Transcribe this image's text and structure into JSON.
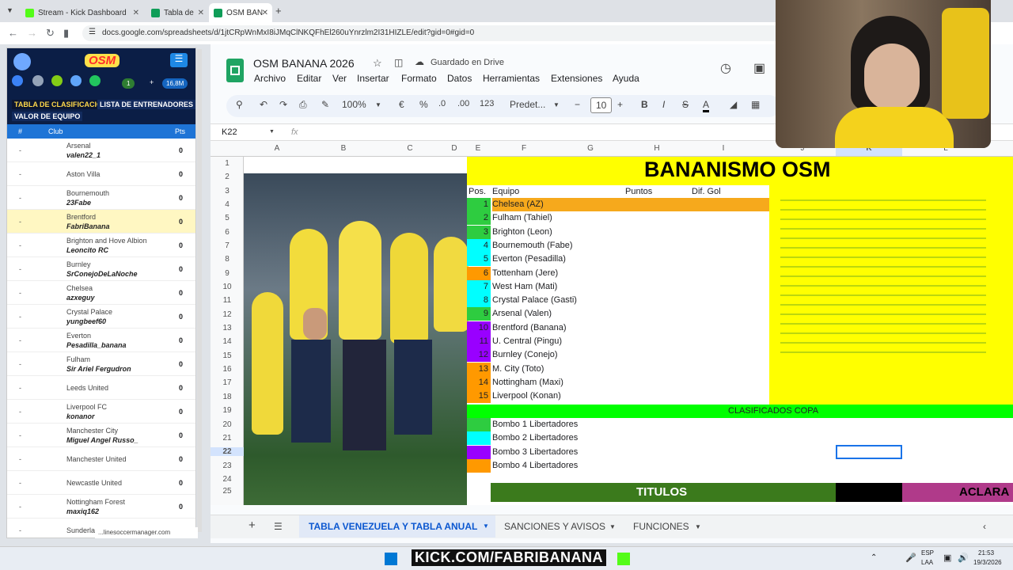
{
  "browser": {
    "tabs": [
      {
        "label": "Stream - Kick Dashboard",
        "color": "#53fc18"
      },
      {
        "label": "Tabla de",
        "color": "#0f9d58"
      },
      {
        "label": "OSM BAN",
        "color": "#0f9d58"
      }
    ],
    "new_tab": "+",
    "url": "docs.google.com/spreadsheets/d/1jtCRpWnMxI8iJMqClNKQFhEl260uYnrzlm2I31HIZLE/edit?gid=0#gid=0"
  },
  "osm": {
    "logo": "OSM",
    "coins": "1",
    "money": "16,8M",
    "nav": [
      "TABLA DE CLASIFICACIÓN",
      "LISTA DE ENTRENADORES",
      "VALOR DE EQUIPO"
    ],
    "header": {
      "num": "#",
      "club": "Club",
      "pts": "Pts"
    },
    "rows": [
      {
        "dash": "-",
        "club": "Arsenal",
        "manager": "valen22_1",
        "pts": "0"
      },
      {
        "dash": "-",
        "club": "Aston Villa",
        "manager": "",
        "pts": "0"
      },
      {
        "dash": "-",
        "club": "Bournemouth",
        "manager": "23Fabe",
        "pts": "0"
      },
      {
        "dash": "-",
        "club": "Brentford",
        "manager": "FabriBanana",
        "pts": "0"
      },
      {
        "dash": "-",
        "club": "Brighton and Hove Albion",
        "manager": "Leoncito RC",
        "pts": "0"
      },
      {
        "dash": "-",
        "club": "Burnley",
        "manager": "SrConejoDeLaNoche",
        "pts": "0"
      },
      {
        "dash": "-",
        "club": "Chelsea",
        "manager": "azxeguy",
        "pts": "0"
      },
      {
        "dash": "-",
        "club": "Crystal Palace",
        "manager": "yungbeef60",
        "pts": "0"
      },
      {
        "dash": "-",
        "club": "Everton",
        "manager": "Pesadilla_banana",
        "pts": "0"
      },
      {
        "dash": "-",
        "club": "Fulham",
        "manager": "Sir Ariel Fergudron",
        "pts": "0"
      },
      {
        "dash": "-",
        "club": "Leeds United",
        "manager": "",
        "pts": "0"
      },
      {
        "dash": "-",
        "club": "Liverpool FC",
        "manager": "konanor",
        "pts": "0"
      },
      {
        "dash": "-",
        "club": "Manchester City",
        "manager": "Miguel Angel Russo_",
        "pts": "0"
      },
      {
        "dash": "-",
        "club": "Manchester United",
        "manager": "",
        "pts": "0"
      },
      {
        "dash": "-",
        "club": "Newcastle United",
        "manager": "",
        "pts": "0"
      },
      {
        "dash": "-",
        "club": "Nottingham Forest",
        "manager": "maxiq162",
        "pts": "0"
      },
      {
        "dash": "-",
        "club": "Sunderland",
        "manager": "",
        "pts": ""
      }
    ],
    "footer": "...linesoccermanager.com"
  },
  "sheets": {
    "title": "OSM BANANA 2026",
    "saved": "Guardado en Drive",
    "menu": [
      "Archivo",
      "Editar",
      "Ver",
      "Insertar",
      "Formato",
      "Datos",
      "Herramientas",
      "Extensiones",
      "Ayuda"
    ],
    "toolbar": {
      "zoom": "100%",
      "currency": "€",
      "percent": "%",
      "dec_minus": ".0",
      "dec_plus": ".00",
      "num": "123",
      "font": "Predet...",
      "size": "10",
      "bold": "B",
      "italic": "I",
      "strike": "S",
      "color": "A"
    },
    "cell_ref": "K22",
    "fx": "fx",
    "columns": [
      "A",
      "B",
      "C",
      "D",
      "E",
      "F",
      "G",
      "H",
      "I",
      "J",
      "K",
      "L"
    ],
    "rows": [
      "1",
      "2",
      "3",
      "4",
      "5",
      "6",
      "7",
      "8",
      "9",
      "10",
      "11",
      "12",
      "13",
      "14",
      "15",
      "16",
      "17",
      "18",
      "19",
      "20",
      "21",
      "22",
      "23",
      "24",
      "25"
    ],
    "banner": "BANANISMO OSM",
    "table_header": {
      "pos": "Pos.",
      "team": "Equipo",
      "pts": "Puntos",
      "dif": "Dif. Gol"
    },
    "standings": [
      {
        "pos": "1",
        "team": "Chelsea (AZ)",
        "color": "#2ecc40"
      },
      {
        "pos": "2",
        "team": "Fulham (Tahiel)",
        "color": "#2ecc40"
      },
      {
        "pos": "3",
        "team": "Brighton (Leon)",
        "color": "#2ecc40"
      },
      {
        "pos": "4",
        "team": "Bournemouth (Fabe)",
        "color": "#00ffff"
      },
      {
        "pos": "5",
        "team": "Everton (Pesadilla)",
        "color": "#00ffff"
      },
      {
        "pos": "6",
        "team": "Tottenham (Jere)",
        "color": "#ff9900"
      },
      {
        "pos": "7",
        "team": "West Ham (Mati)",
        "color": "#00ffff"
      },
      {
        "pos": "8",
        "team": "Crystal Palace (Gasti)",
        "color": "#00ffff"
      },
      {
        "pos": "9",
        "team": "Arsenal (Valen)",
        "color": "#2ecc40"
      },
      {
        "pos": "10",
        "team": "Brentford (Banana)",
        "color": "#9900ff"
      },
      {
        "pos": "11",
        "team": "U. Central (Pingu)",
        "color": "#9900ff"
      },
      {
        "pos": "12",
        "team": "Burnley (Conejo)",
        "color": "#9900ff"
      },
      {
        "pos": "13",
        "team": "M. City (Toto)",
        "color": "#ff9900"
      },
      {
        "pos": "14",
        "team": "Nottingham (Maxi)",
        "color": "#ff9900"
      },
      {
        "pos": "15",
        "team": "Liverpool (Konan)",
        "color": "#ff9900"
      }
    ],
    "copa": "CLASIFICADOS COPA",
    "bombos": [
      {
        "label": "Bombo 1 Libertadores",
        "color": "#2ecc40"
      },
      {
        "label": "Bombo 2 Libertadores",
        "color": "#00ffff"
      },
      {
        "label": "Bombo 3 Libertadores",
        "color": "#9900ff"
      },
      {
        "label": "Bombo 4 Libertadores",
        "color": "#ff9900"
      }
    ],
    "titulos": "TITULOS",
    "aclara": "ACLARA",
    "sheet_tabs": [
      "TABLA VENEZUELA Y TABLA ANUAL",
      "SANCIONES Y AVISOS",
      "FUNCIONES"
    ]
  },
  "taskbar": {
    "kick": "KICK.COM/FABRIBANANA",
    "lang": "ESP",
    "lang2": "LAA",
    "time": "21:53",
    "date": "19/3/2026"
  }
}
